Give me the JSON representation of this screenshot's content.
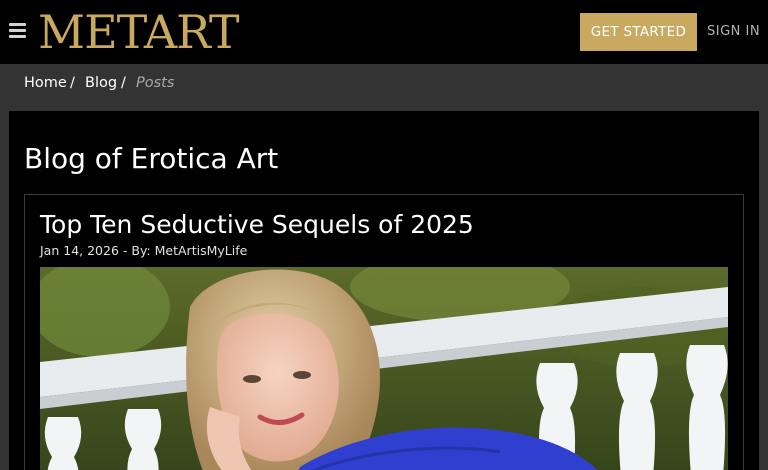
{
  "header": {
    "logo_text": "METART",
    "logo_tm": "™",
    "get_started_label": "GET STARTED",
    "sign_in_label": "SIGN IN",
    "brand_color": "#c9a960"
  },
  "breadcrumb": {
    "items": [
      {
        "label": "Home"
      },
      {
        "label": "Blog"
      },
      {
        "label": "Posts"
      }
    ],
    "separator": "/"
  },
  "page": {
    "title": "Blog of Erotica Art"
  },
  "post": {
    "title": "Top Ten Seductive Sequels of 2025",
    "date": "Jan 14, 2026",
    "by_prefix": " - By: ",
    "author": "MetArtisMyLife"
  }
}
